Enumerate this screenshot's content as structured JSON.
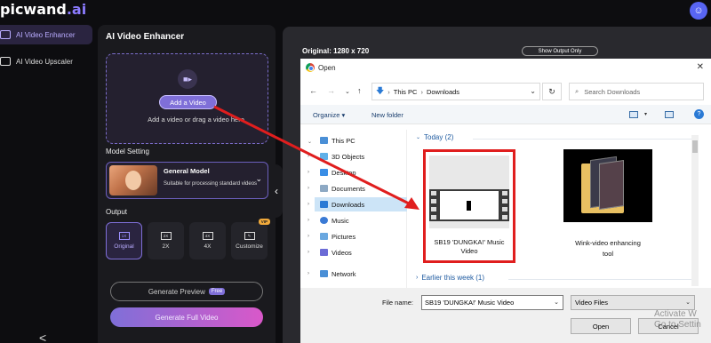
{
  "brand": {
    "name": "picwand",
    "suffix": ".ai"
  },
  "nav": {
    "items": [
      {
        "label": "AI Video Enhancer",
        "active": true
      },
      {
        "label": "AI Video Upscaler",
        "active": false
      }
    ],
    "collapse_glyph": "<"
  },
  "panel": {
    "title": "AI Video Enhancer",
    "add_button": "Add a Video",
    "drop_hint": "Add a video or drag a video here",
    "model_setting_label": "Model Setting",
    "model": {
      "name": "General Model",
      "description": "Suitable for processing standard videos"
    },
    "output_label": "Output",
    "outputs": [
      {
        "box": "1X",
        "label": "Original",
        "active": true
      },
      {
        "box": "2X",
        "label": "2X",
        "active": false
      },
      {
        "box": "4X",
        "label": "4X",
        "active": false
      },
      {
        "box": "✎",
        "label": "Customize",
        "active": false,
        "badge": "VIP"
      }
    ],
    "generate_preview": "Generate Preview",
    "free_badge": "Free",
    "generate_full": "Generate Full Video"
  },
  "preview": {
    "original_info": "Original: 1280 x 720",
    "show_output_only": "Show Output Only"
  },
  "dialog": {
    "title": "Open",
    "path": [
      "This PC",
      "Downloads"
    ],
    "search_placeholder": "Search Downloads",
    "organize": "Organize ▾",
    "new_folder": "New folder",
    "tree": [
      {
        "label": "This PC",
        "icon": "pc-icon",
        "color": "#4a8fd6"
      },
      {
        "label": "3D Objects",
        "icon": "cube-icon",
        "color": "#5fb0e8"
      },
      {
        "label": "Desktop",
        "icon": "desktop-icon",
        "color": "#3a8ee6"
      },
      {
        "label": "Documents",
        "icon": "documents-icon",
        "color": "#8da9c4"
      },
      {
        "label": "Downloads",
        "icon": "downloads-icon",
        "color": "#2a7ad5",
        "selected": true
      },
      {
        "label": "Music",
        "icon": "music-icon",
        "color": "#3a7ad5"
      },
      {
        "label": "Pictures",
        "icon": "pictures-icon",
        "color": "#6aa8e0"
      },
      {
        "label": "Videos",
        "icon": "videos-icon",
        "color": "#6b6bd6"
      },
      {
        "label": "Network",
        "icon": "network-icon",
        "color": "#4a8fd6"
      }
    ],
    "groups": {
      "today": "Today (2)",
      "earlier": "Earlier this week (1)"
    },
    "files": [
      {
        "name": "SB19 'DUNGKA!' Music Video",
        "name_lines": [
          "SB19 'DUNGKA!' Music",
          "Video"
        ],
        "selected": true
      },
      {
        "name": "Wink-video enhancing tool",
        "name_lines": [
          "Wink-video enhancing",
          "tool"
        ],
        "selected": false
      }
    ],
    "file_name_label": "File name:",
    "file_name_value": "SB19 'DUNGKA!' Music Video",
    "file_type": "Video Files",
    "open_button": "Open",
    "cancel_button": "Cancel"
  },
  "watermark": {
    "line1": "Activate W",
    "line2": "Go to Settin"
  },
  "colors": {
    "accent": "#7f6fd8",
    "annotation_red": "#e01e1e",
    "discord": "#5865f2"
  }
}
